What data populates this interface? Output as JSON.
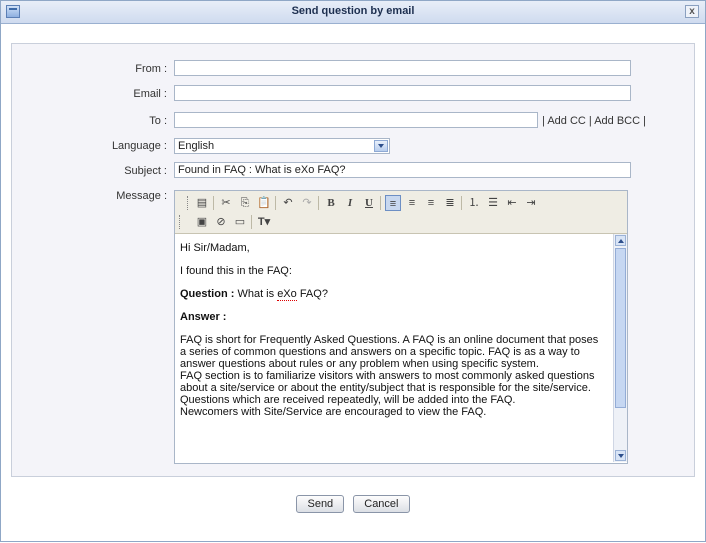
{
  "window": {
    "title": "Send question by email",
    "close_label": "x"
  },
  "form": {
    "from_label": "From :",
    "from_value": "",
    "email_label": "Email :",
    "email_value": "",
    "to_label": "To :",
    "to_value": "",
    "add_cc": "Add CC",
    "add_bcc": "Add BCC",
    "link_sep": "|",
    "language_label": "Language :",
    "language_value": "English",
    "subject_label": "Subject :",
    "subject_value": "Found in FAQ : What is eXo FAQ?",
    "message_label": "Message :"
  },
  "toolbar": {
    "bold": "B",
    "italic": "I",
    "underline": "U",
    "icons": [
      "source-icon",
      "cut-icon",
      "copy-icon",
      "paste-icon",
      "undo-icon",
      "redo-icon",
      "bold-icon",
      "italic-icon",
      "underline-icon",
      "align-left-icon",
      "align-center-icon",
      "align-right-icon",
      "justify-icon",
      "numbered-list-icon",
      "bullet-list-icon",
      "outdent-icon",
      "indent-icon",
      "image-icon",
      "link-icon",
      "table-icon",
      "text-color-icon"
    ]
  },
  "message": {
    "greeting": "Hi Sir/Madam,",
    "intro": "I found this in the FAQ:",
    "question_label": "Question :",
    "question_text": "What is ",
    "question_brand": "eXo",
    "question_tail": " FAQ?",
    "answer_label": "Answer :",
    "answer_lines": [
      "FAQ is short for Frequently Asked Questions. A FAQ is an online document that poses",
      "a series of common questions and answers on a specific topic. FAQ is as a way to",
      "answer questions about rules or any problem when using specific system.",
      "FAQ section is to familiarize visitors with answers to most commonly asked questions",
      "about a site/service or about the entity/subject that is responsible for the site/service.",
      "Questions which are received repeatedly, will be added into the FAQ.",
      "Newcomers with Site/Service are encouraged to view the FAQ."
    ]
  },
  "actions": {
    "send": "Send",
    "cancel": "Cancel"
  },
  "colors": {
    "title_bar": "#cfdbef",
    "panel_bg": "#f4f4f9",
    "toolbar_bg": "#efede4"
  }
}
